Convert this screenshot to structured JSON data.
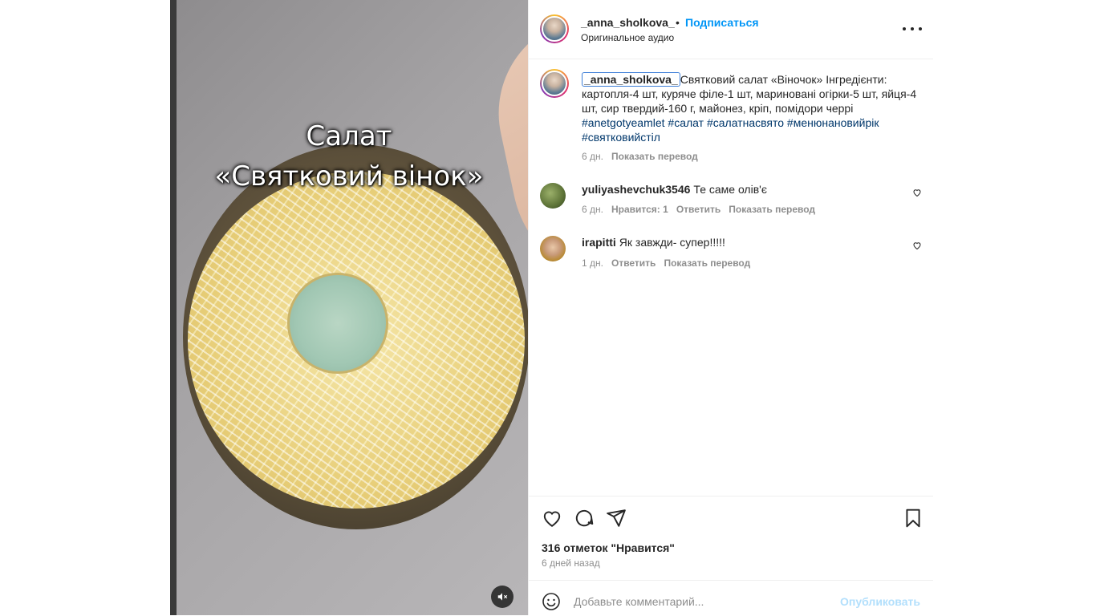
{
  "post": {
    "username": "_anna_sholkova_",
    "separator": "•",
    "follow_label": "Подписаться",
    "audio_label": "Оригинальное аудио"
  },
  "media": {
    "caption_line1": "Салат",
    "caption_line2": "«Святковий вінок»"
  },
  "caption": {
    "username": "_anna_sholkova_",
    "text": "Святковий салат «Віночок» Інгредієнти: картопля-4 шт, куряче філе-1 шт, мариновані огірки-5 шт, яйця-4 шт, сир твердий-160 г, майонез, кріп, помідори черрі ",
    "tags": [
      "#anetgotyeamlet",
      "#салат",
      "#салатнасвято",
      "#менюнановийрік",
      "#святковийстіл"
    ],
    "age": "6 дн.",
    "translate": "Показать перевод"
  },
  "comments": [
    {
      "username": "yuliyashevchuk3546",
      "text": "Те саме олів'є",
      "age": "6 дн.",
      "likes": "Нравится: 1",
      "reply": "Ответить",
      "translate": "Показать перевод"
    },
    {
      "username": "irapitti",
      "text": "Як завжди- супер!!!!!",
      "age": "1 дн.",
      "reply": "Ответить",
      "translate": "Показать перевод"
    }
  ],
  "stats": {
    "likes": "316 отметок \"Нравится\"",
    "posted": "6 дней назад"
  },
  "comment_box": {
    "placeholder": "Добавьте комментарий...",
    "publish": "Опубликовать"
  },
  "colors": {
    "link": "#0095f6",
    "hashtag": "#00376b",
    "muted": "#8e8e8e",
    "publish_disabled": "#b2dffc"
  },
  "icons": [
    "heart-icon",
    "comment-icon",
    "share-icon",
    "bookmark-icon",
    "emoji-icon",
    "more-icon",
    "mute-icon"
  ]
}
